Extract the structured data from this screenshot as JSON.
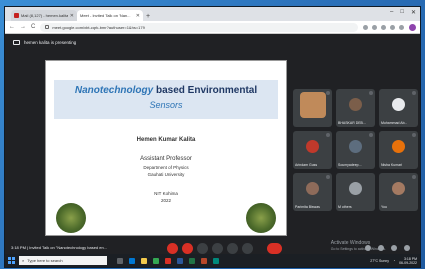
{
  "browser": {
    "tabs": [
      {
        "label": "Mail (8,127) - hemen.kalita@..."
      },
      {
        "label": "Meet - Invited Talk on 'Nan..."
      }
    ],
    "new_tab": "+",
    "window_controls": {
      "minimize": "–",
      "maximize": "□",
      "close": "✕"
    },
    "url": "meet.google.com/xbt-cqrk-bmr?authuser=1&hs=179",
    "nav": {
      "back": "←",
      "forward": "→",
      "reload": "C"
    }
  },
  "meet": {
    "presenting_text": "hemen kalita is presenting",
    "slide": {
      "title_prefix": "Nanotechnology",
      "title_rest": " based Environmental",
      "subtitle": "Sensors",
      "name": "Hemen Kumar Kalita",
      "role": "Assistant Professor",
      "department": "Department of Physics",
      "university": "Gauhati University",
      "event": "NIT Kohima",
      "year": "2022"
    },
    "tiles": [
      {
        "name": "",
        "color": "#c08a5a"
      },
      {
        "name": "BHASKAR DEB...",
        "color": "#7b5e4a"
      },
      {
        "name": "Muhammad Ab...",
        "color": "#e8eaed"
      },
      {
        "name": "Arindam Guss",
        "color": "#c0392b"
      },
      {
        "name": "Soumyadeep...",
        "color": "#5d6d7e"
      },
      {
        "name": "Nisha Kumari",
        "color": "#e8710a"
      },
      {
        "name": "Parimita Biswas",
        "color": "#8e6b5a"
      },
      {
        "name": "M others",
        "color": "#9aa0a6"
      },
      {
        "name": "You",
        "color": "#a47a62"
      }
    ],
    "meeting_time": "3:18 PM",
    "meeting_title": "Invited Talk on \"Nanotechnology based en...",
    "activate": "Activate Windows",
    "activate_sub": "Go to Settings to activate Windows."
  },
  "taskbar": {
    "search_placeholder": "Type here to search",
    "weather": "27°C Sunny",
    "time": "3:18 PM",
    "date": "06-09-2022"
  }
}
